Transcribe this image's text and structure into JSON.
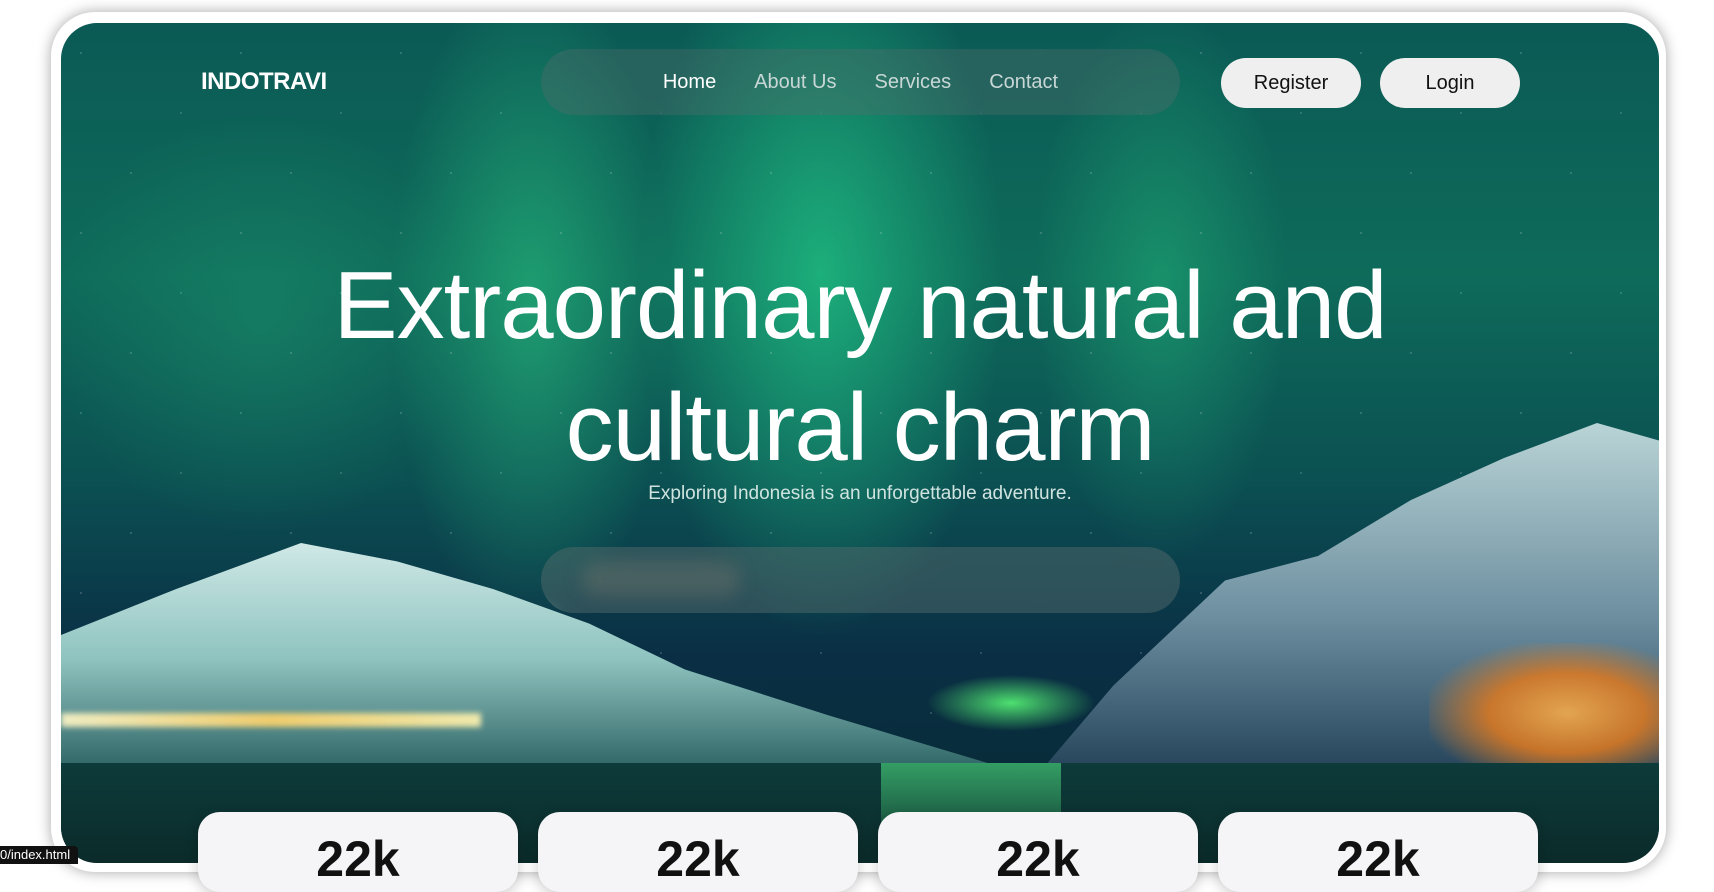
{
  "brand": {
    "logo": "INDOTRAVI"
  },
  "nav": {
    "items": [
      {
        "label": "Home",
        "active": true
      },
      {
        "label": "About Us",
        "active": false
      },
      {
        "label": "Services",
        "active": false
      },
      {
        "label": "Contact",
        "active": false
      }
    ]
  },
  "auth": {
    "register_label": "Register",
    "login_label": "Login"
  },
  "hero": {
    "headline_line1": "Extraordinary natural and",
    "headline_line2": "cultural charm",
    "subtitle": "Exploring Indonesia is an unforgettable adventure."
  },
  "stats": [
    {
      "value": "22k"
    },
    {
      "value": "22k"
    },
    {
      "value": "22k"
    },
    {
      "value": "22k"
    }
  ],
  "statusbar": {
    "url": "0/index.html"
  }
}
